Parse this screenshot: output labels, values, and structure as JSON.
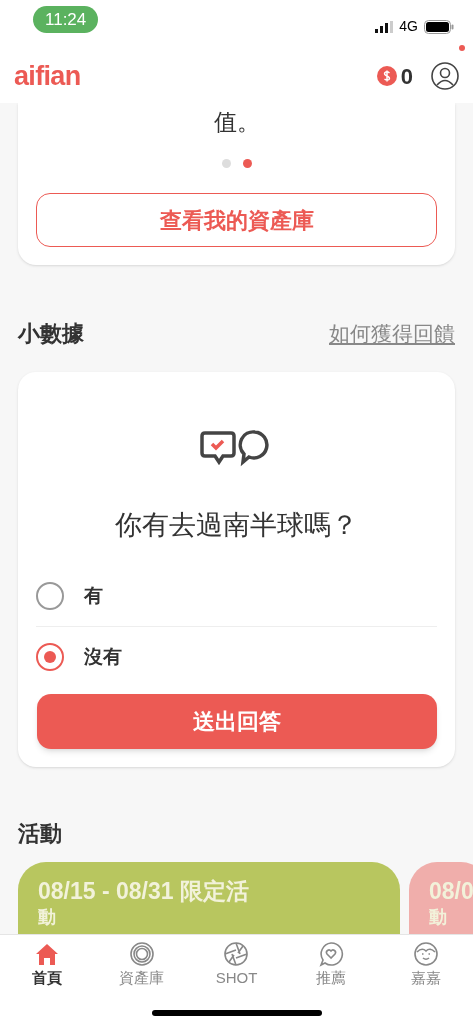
{
  "status_bar": {
    "time": "11:24",
    "network": "4G"
  },
  "header": {
    "logo": "aifian",
    "coins": "0",
    "notification": true
  },
  "asset_card": {
    "text_tail": "值。",
    "dots": [
      {
        "selected": false
      },
      {
        "selected": true
      }
    ],
    "button": "查看我的資產庫"
  },
  "data_section": {
    "title": "小數據",
    "link": "如何獲得回饋"
  },
  "survey": {
    "question": "你有去過南半球嗎？",
    "options": [
      {
        "label": "有",
        "selected": false
      },
      {
        "label": "沒有",
        "selected": true
      }
    ],
    "submit": "送出回答"
  },
  "events_section": {
    "title": "活動"
  },
  "events": [
    {
      "title": "08/15 - 08/31 限定活",
      "title_line2": "動",
      "color": "#b8c65f"
    },
    {
      "title": "08/0",
      "title_line2": "動",
      "color": "#f0aeab"
    }
  ],
  "tabs": [
    {
      "label": "首頁",
      "selected": true
    },
    {
      "label": "資產庫",
      "selected": false
    },
    {
      "label": "SHOT",
      "selected": false
    },
    {
      "label": "推薦",
      "selected": false
    },
    {
      "label": "嘉嘉",
      "selected": false
    }
  ]
}
